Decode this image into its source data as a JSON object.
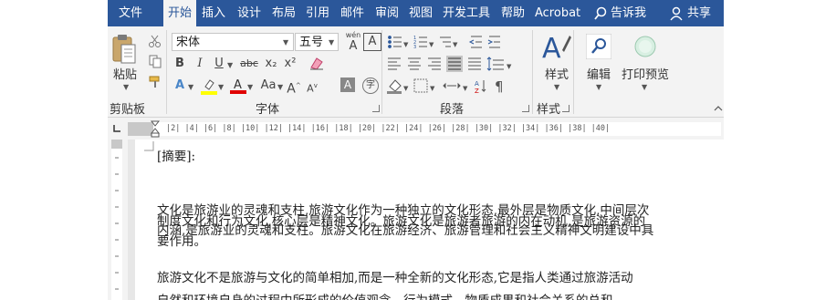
{
  "tabs": {
    "file": "文件",
    "home": "开始",
    "insert": "插入",
    "design": "设计",
    "layout": "布局",
    "references": "引用",
    "mailings": "邮件",
    "review": "审阅",
    "view": "视图",
    "developer": "开发工具",
    "help": "帮助",
    "acrobat": "Acrobat",
    "tell_me": "告诉我",
    "share": "共享"
  },
  "clipboard": {
    "paste_label": "粘贴",
    "group_label": "剪贴板"
  },
  "font": {
    "font_name": "宋体",
    "font_size": "五号",
    "bold": "B",
    "italic": "I",
    "underline": "U",
    "strikethrough": "abc",
    "subscript": "x₂",
    "superscript": "x²",
    "change_case": "Aa",
    "grow": "A",
    "shrink": "A",
    "wen": "wén",
    "group_label": "字体"
  },
  "paragraph": {
    "group_label": "段落"
  },
  "styles": {
    "button_label": "样式",
    "group_label": "样式"
  },
  "editing": {
    "button_label": "编辑"
  },
  "print": {
    "button_label": "打印预览"
  },
  "ruler": {
    "marks": "|2| |4| |6| |8| |10| |12| |14| |16| |18| |20| |22| |24| |26| |28| |30| |32| |34| |36| |38| |40|"
  },
  "document": {
    "abstract_heading": "[摘要]:",
    "overlap_line1": "文化是旅游业的灵魂和支柱,旅游文化作为一种独立的文化形态,最外层是物质文化,中间层次",
    "overlap_line2": "制度文化和行为文化,核心层是精神文化。旅游文化是旅游者旅游的内在动机,是旅游资源的",
    "overlap_line3": "内涵,是旅游业的灵魂和支柱。旅游文化在旅游经济、旅游管理和社会主义精神文明建设中具",
    "overlap_line4": "要作用。",
    "para2_line1": "旅游文化不是旅游与文化的简单相加,而是一种全新的文化形态,它是指人类通过旅游活动",
    "para2_line2": "自然和环境自身的过程中所形成的价值观念、行为模式、物质成果和社会关系的总和。"
  },
  "colors": {
    "tab_bar": "#2b579a",
    "ribbon": "#f3f3f3",
    "highlight_yellow": "#ffff00",
    "font_red": "#e00000"
  }
}
